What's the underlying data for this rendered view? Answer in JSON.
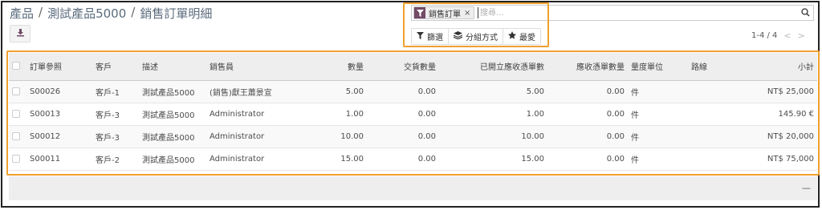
{
  "breadcrumb": [
    "產品",
    "測試產品5000",
    "銷售訂單明細"
  ],
  "breadcrumb_sep": "/",
  "search": {
    "facet_label": "銷售訂單",
    "facet_remove": "×",
    "placeholder": "搜尋..."
  },
  "buttons": {
    "filter": "篩選",
    "group_by": "分組方式",
    "favorites": "最愛"
  },
  "pager": {
    "text": "1-4 / 4",
    "prev": "<",
    "next": ">"
  },
  "table": {
    "headers": {
      "order_ref": "訂單參照",
      "customer": "客戶",
      "description": "描述",
      "salesperson": "銷售員",
      "quantity": "數量",
      "delivered_qty": "交貨數量",
      "invoiced_qty": "已開立應收憑單數",
      "to_invoice_qty": "應收憑單數量",
      "uom": "量度單位",
      "route": "路線",
      "subtotal": "小計"
    },
    "rows": [
      {
        "order_ref": "S00026",
        "customer": "客戶-1",
        "description": "測試產品5000",
        "salesperson": "(銷售)獻王蕭景宣",
        "quantity": "5.00",
        "delivered_qty": "0.00",
        "invoiced_qty": "5.00",
        "to_invoice_qty": "0.00",
        "uom": "件",
        "route": "",
        "subtotal": "NT$ 25,000"
      },
      {
        "order_ref": "S00013",
        "customer": "客戶-3",
        "description": "測試產品5000",
        "salesperson": "Administrator",
        "quantity": "1.00",
        "delivered_qty": "0.00",
        "invoiced_qty": "1.00",
        "to_invoice_qty": "0.00",
        "uom": "件",
        "route": "",
        "subtotal": "145.90 €"
      },
      {
        "order_ref": "S00012",
        "customer": "客戶-3",
        "description": "測試產品5000",
        "salesperson": "Administrator",
        "quantity": "10.00",
        "delivered_qty": "0.00",
        "invoiced_qty": "10.00",
        "to_invoice_qty": "0.00",
        "uom": "件",
        "route": "",
        "subtotal": "NT$ 20,000"
      },
      {
        "order_ref": "S00011",
        "customer": "客戶-2",
        "description": "測試產品5000",
        "salesperson": "Administrator",
        "quantity": "15.00",
        "delivered_qty": "0.00",
        "invoiced_qty": "15.00",
        "to_invoice_qty": "0.00",
        "uom": "件",
        "route": "",
        "subtotal": "NT$ 75,000"
      }
    ]
  },
  "footer": {
    "dash": "—"
  },
  "colors": {
    "accent": "#714b67",
    "highlight": "#f0a030",
    "header_bg": "#eeeeee"
  }
}
